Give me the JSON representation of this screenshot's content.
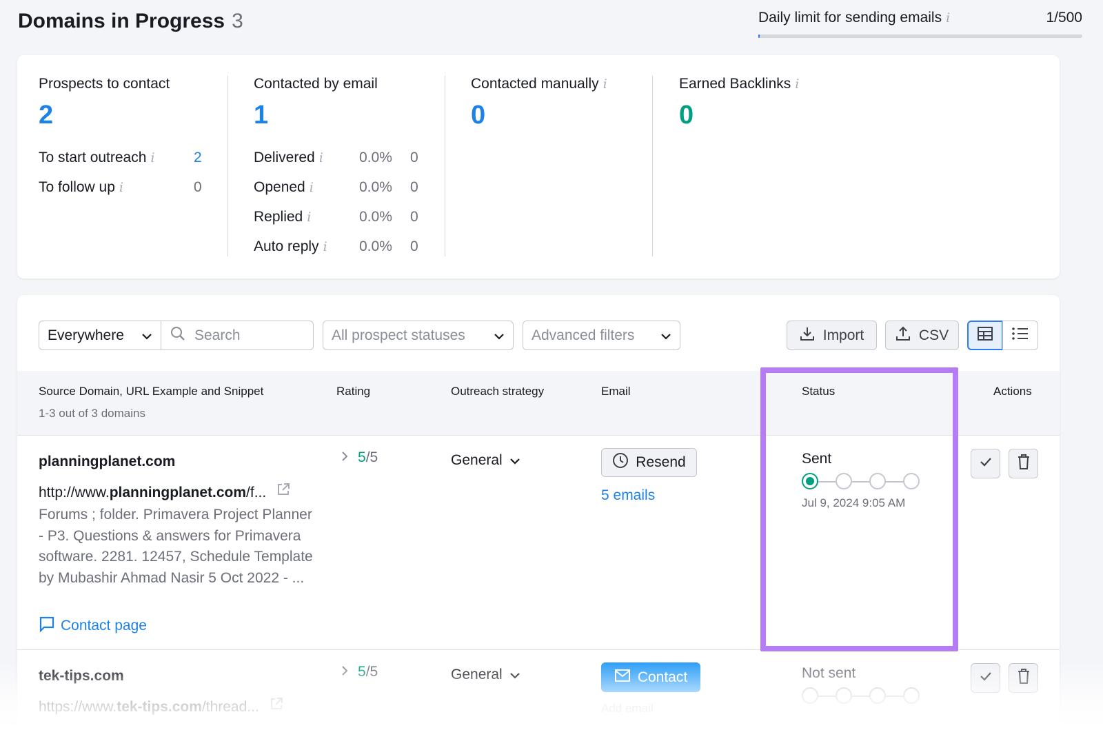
{
  "header": {
    "title": "Domains in Progress",
    "count": "3"
  },
  "daily_limit": {
    "label": "Daily limit for sending emails",
    "value": "1/500",
    "fraction": 0.002
  },
  "stats": {
    "prospects": {
      "label": "Prospects to contact",
      "value": "2",
      "rows": [
        {
          "label": "To start outreach",
          "value": "2"
        },
        {
          "label": "To follow up",
          "value": "0"
        }
      ]
    },
    "email": {
      "label": "Contacted by email",
      "value": "1",
      "rows": [
        {
          "label": "Delivered",
          "pct": "0.0%",
          "value": "0"
        },
        {
          "label": "Opened",
          "pct": "0.0%",
          "value": "0"
        },
        {
          "label": "Replied",
          "pct": "0.0%",
          "value": "0"
        },
        {
          "label": "Auto reply",
          "pct": "0.0%",
          "value": "0"
        }
      ]
    },
    "manual": {
      "label": "Contacted manually",
      "value": "0"
    },
    "backlinks": {
      "label": "Earned Backlinks",
      "value": "0"
    }
  },
  "toolbar": {
    "scope": "Everywhere",
    "search_placeholder": "Search",
    "status_filter": "All prospect statuses",
    "advanced": "Advanced filters",
    "import": "Import",
    "csv": "CSV"
  },
  "table": {
    "headers": {
      "source": "Source Domain, URL Example and Snippet",
      "source_sub": "1-3 out of 3 domains",
      "rating": "Rating",
      "strategy": "Outreach strategy",
      "email": "Email",
      "status": "Status",
      "actions": "Actions"
    },
    "rows": [
      {
        "domain": "planningplanet.com",
        "url_prefix": "http://www.",
        "url_bold": "planningplanet.com",
        "url_suffix": "/f...",
        "snippet": "Forums ; folder. Primavera Project Planner - P3. Questions & answers for Primavera software. 2281. 12457, Schedule Template by Mubashir Ahmad Nasir 5 Oct 2022 - ...",
        "contact_page": "Contact page",
        "rating": "5",
        "rating_max": "/5",
        "strategy": "General",
        "email_action": "Resend",
        "emails": "5 emails",
        "status": "Sent",
        "status_step": 1,
        "date": "Jul 9, 2024 9:05 AM"
      },
      {
        "domain": "tek-tips.com",
        "url_prefix": "https://www.",
        "url_bold": "tek-tips.com",
        "url_suffix": "/thread...",
        "rating": "5",
        "rating_max": "/5",
        "strategy": "General",
        "email_action": "Contact",
        "emails": "Add email",
        "status": "Not sent",
        "status_step": 0
      }
    ]
  },
  "colors": {
    "accent": "#2b7cf6",
    "link": "#1d82e8",
    "success": "#009f81",
    "highlight": "#b57cf5"
  }
}
